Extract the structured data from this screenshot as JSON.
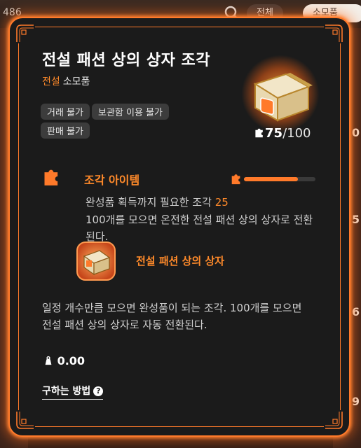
{
  "background": {
    "count_text": "486",
    "tabs": [
      {
        "label": "전체"
      },
      {
        "label": "소모품"
      }
    ],
    "side_numbers": [
      "0",
      "5",
      "6",
      "9"
    ]
  },
  "tooltip": {
    "title": "전설 패션 상의 상자 조각",
    "grade": "전설",
    "category": "소모품",
    "tags": [
      "거래 불가",
      "보관함 이용 불가",
      "판매 불가"
    ],
    "item_icon": "golden-chest-icon",
    "count_current": "75",
    "count_max": "/100",
    "progress": 0.75,
    "section": {
      "title": "조각 아이템",
      "required_text": "완성품 획득까지 필요한 조각",
      "required_num": "25",
      "description": "100개를 모으면 온전한 전설 패션 상의 상자로 전환된다."
    },
    "result_item": {
      "name": "전설 패션 상의 상자",
      "icon": "golden-chest-icon"
    },
    "description": "일정 개수만큼 모으면 완성품이 되는 조각. 100개를 모으면 전설 패션 상의 상자로 자동 전환된다.",
    "price": "0.00",
    "how_to_label": "구하는 방법",
    "help_icon": "?",
    "colors": {
      "accent": "#ff7a2a",
      "panel": "#1b1b1b"
    }
  }
}
